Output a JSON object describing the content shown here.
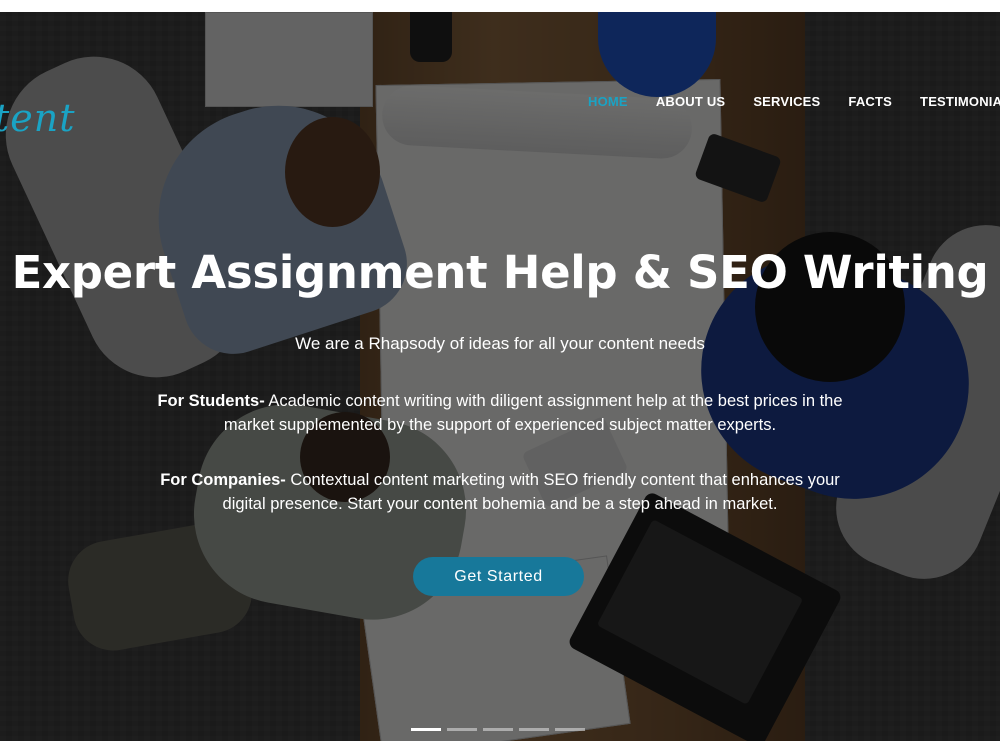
{
  "brand": {
    "logo_text": "tent",
    "accent_color": "#1aa3c4"
  },
  "nav": {
    "items": [
      {
        "label": "HOME",
        "active": true
      },
      {
        "label": "ABOUT US",
        "active": false
      },
      {
        "label": "SERVICES",
        "active": false
      },
      {
        "label": "FACTS",
        "active": false
      },
      {
        "label": "TESTIMONIAL",
        "active": false
      }
    ]
  },
  "hero": {
    "headline": "Expert Assignment Help & SEO Writing",
    "tagline": "We are a Rhapsody of ideas for all your content needs",
    "students": {
      "label": "For Students-",
      "text": " Academic content writing with diligent assignment help at the best prices in the market supplemented by the support of experienced subject matter experts."
    },
    "companies": {
      "label": "For Companies-",
      "text": " Contextual content marketing with SEO friendly content that enhances your digital presence. Start your content bohemia and be a step ahead in market."
    },
    "cta_label": "Get Started",
    "cta_color": "#17789a",
    "slider": {
      "slide_count": 5,
      "active_slide": 1
    }
  }
}
